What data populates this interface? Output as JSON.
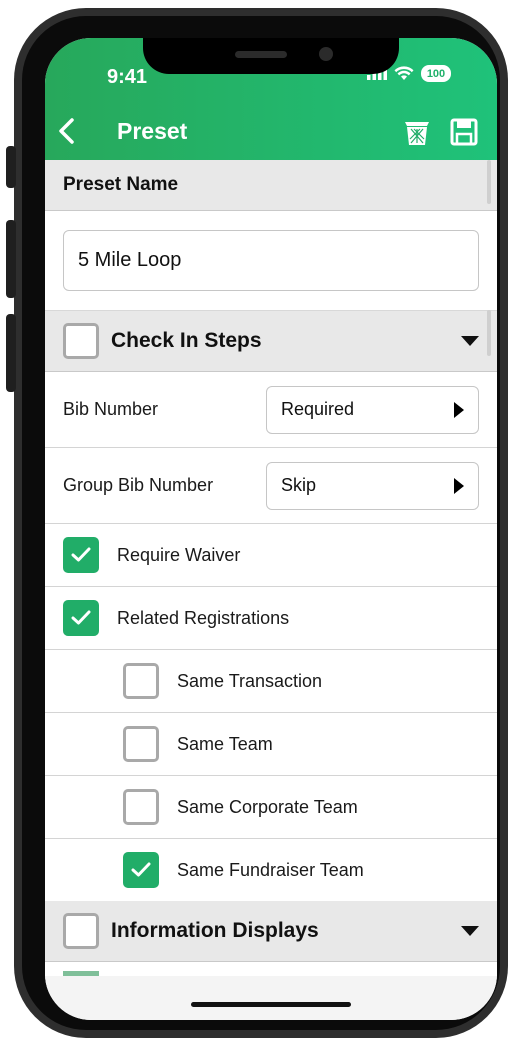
{
  "status_bar": {
    "time": "9:41",
    "battery": "100"
  },
  "nav": {
    "title": "Preset",
    "back_icon": "chevron-left-icon",
    "trash_icon": "trash-icon",
    "save_icon": "floppy-disk-icon"
  },
  "preset_name": {
    "header": "Preset Name",
    "value": "5 Mile Loop"
  },
  "check_in": {
    "header": "Check In Steps",
    "bib_number": {
      "label": "Bib Number",
      "value": "Required"
    },
    "group_bib_number": {
      "label": "Group Bib Number",
      "value": "Skip"
    },
    "items": [
      {
        "label": "Require Waiver",
        "checked": true
      },
      {
        "label": "Related Registrations",
        "checked": true
      },
      {
        "label": "Same Transaction",
        "checked": false
      },
      {
        "label": "Same Team",
        "checked": false
      },
      {
        "label": "Same Corporate Team",
        "checked": false
      },
      {
        "label": "Same Fundraiser Team",
        "checked": true
      }
    ]
  },
  "info_displays": {
    "header": "Information Displays"
  },
  "colors": {
    "brand_green": "#21ad68",
    "header_gradient_start": "#27a85b",
    "header_gradient_end": "#1fc27a"
  }
}
